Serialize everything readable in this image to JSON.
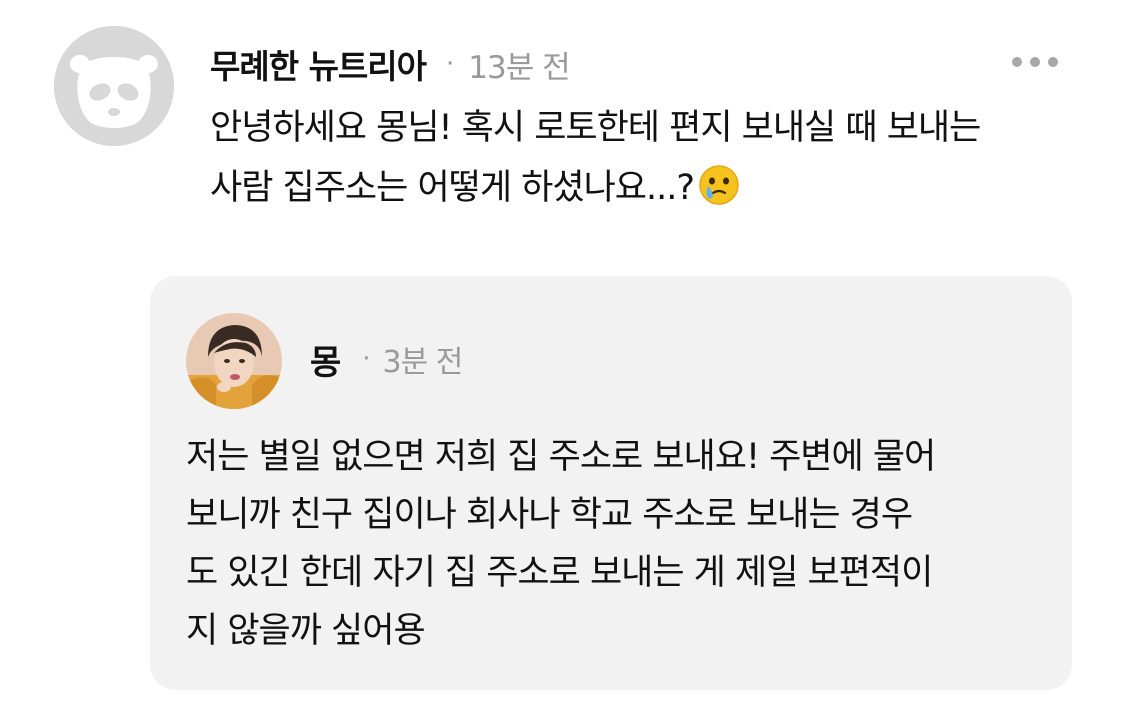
{
  "comment": {
    "username": "무례한 뉴트리아",
    "separator": "·",
    "time": "13분 전",
    "text_lines": [
      "안녕하세요 몽님! 혹시 로토한테 편지 보내실 때 보내는",
      "사람 집주소는 어떻게 하셨나요...?"
    ],
    "emoji_icon": "face-holding-back-tears-icon",
    "more_icon": "more-horizontal-icon"
  },
  "reply": {
    "username": "몽",
    "separator": "·",
    "time": "3분 전",
    "text_lines": [
      "저는 별일 없으면 저희 집 주소로 보내요! 주변에 물어",
      "보니까 친구 집이나 회사나 학교 주소로 보내는 경우",
      "도 있긴 한데 자기 집 주소로 보내는 게 제일 보편적이",
      "지 않을까 싶어용"
    ]
  },
  "colors": {
    "card_background": "#f2f2f3",
    "muted_text": "#9a9a9a",
    "default_avatar": "#d8d8d8"
  }
}
